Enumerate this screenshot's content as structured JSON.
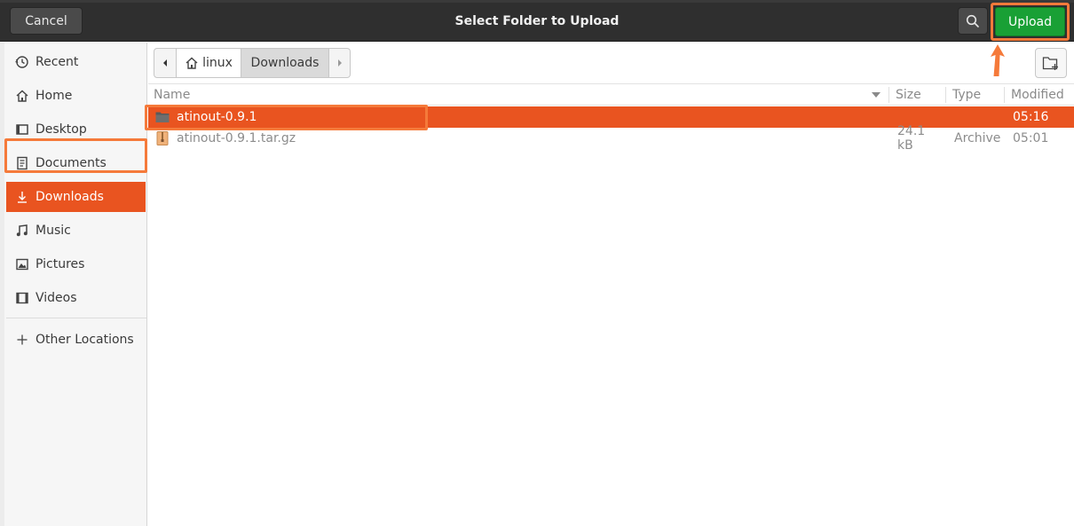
{
  "header": {
    "cancel_label": "Cancel",
    "title": "Select Folder to Upload",
    "upload_label": "Upload"
  },
  "sidebar": {
    "items": [
      {
        "label": "Recent",
        "icon": "clock-icon"
      },
      {
        "label": "Home",
        "icon": "home-icon"
      },
      {
        "label": "Desktop",
        "icon": "desktop-icon"
      },
      {
        "label": "Documents",
        "icon": "document-icon"
      },
      {
        "label": "Downloads",
        "icon": "download-icon",
        "active": true
      },
      {
        "label": "Music",
        "icon": "music-note-icon"
      },
      {
        "label": "Pictures",
        "icon": "picture-icon"
      },
      {
        "label": "Videos",
        "icon": "video-icon"
      }
    ],
    "other_locations": {
      "label": "Other Locations",
      "icon": "plus-icon"
    }
  },
  "pathbar": {
    "segments": [
      "linux",
      "Downloads"
    ]
  },
  "file_list": {
    "columns": {
      "name": "Name",
      "size": "Size",
      "type": "Type",
      "modified": "Modified"
    },
    "rows": [
      {
        "name": "atinout-0.9.1",
        "size": "",
        "type": "",
        "modified": "05:16",
        "icon": "folder-icon",
        "selected": true
      },
      {
        "name": "atinout-0.9.1.tar.gz",
        "size": "24.1 kB",
        "type": "Archive",
        "modified": "05:01",
        "icon": "archive-icon",
        "selected": false
      }
    ]
  },
  "colors": {
    "accent": "#e95420",
    "upload_green": "#19a035",
    "highlight_outline": "#f57a3a",
    "header_bg": "#2f2f2f"
  }
}
